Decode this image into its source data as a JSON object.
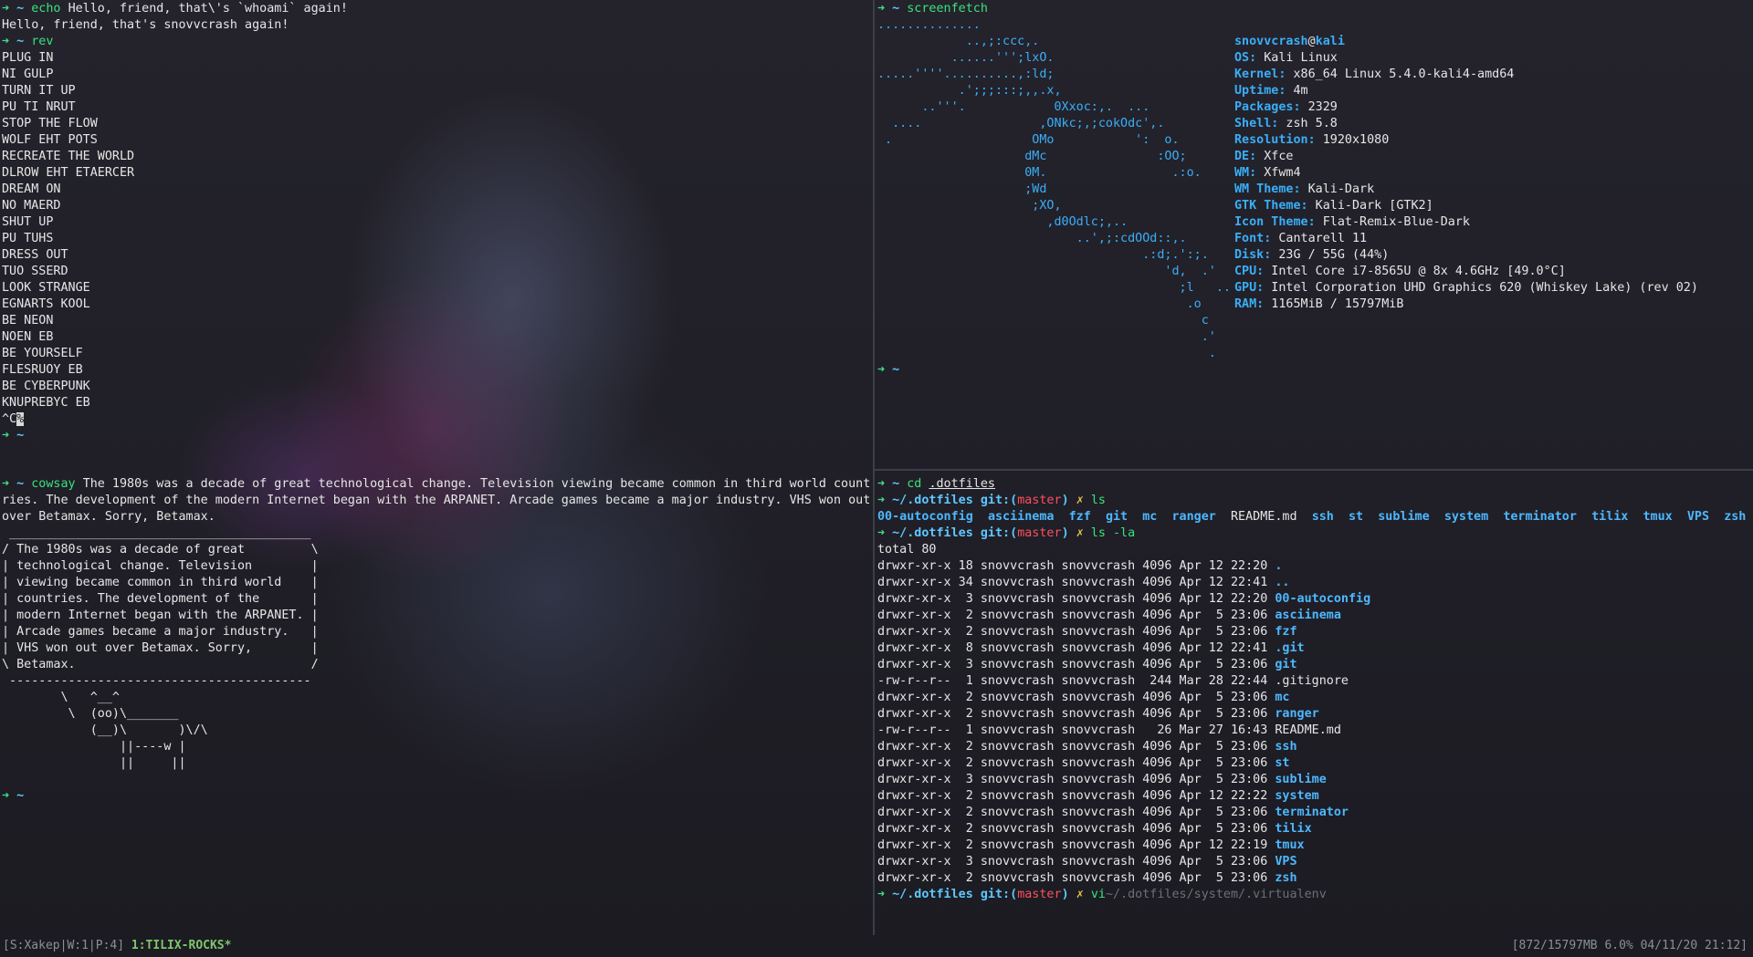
{
  "colors": {
    "background": "#1e1d25",
    "prompt_arrow": "#3ee08a",
    "prompt_path": "#5ec8ff",
    "command": "#39e37c",
    "git_branch": "#ff4f5e",
    "directory": "#4db8ff",
    "screenfetch_accent": "#3aaef8"
  },
  "icons": {
    "prompt": "arrow-icon",
    "dirty": "cross-mark-icon"
  },
  "tl": {
    "echo_prompt": "➜",
    "echo_path": "~",
    "echo_cmd": "echo",
    "echo_args": "Hello, friend, that\\'s `whoami` again!",
    "echo_output": "Hello, friend, that's snovvcrash again!",
    "rev_prompt": "➜",
    "rev_path": "~",
    "rev_cmd": "rev",
    "rev_lines": [
      "PLUG IN",
      "NI GULP",
      "TURN IT UP",
      "PU TI NRUT",
      "STOP THE FLOW",
      "WOLF EHT POTS",
      "RECREATE THE WORLD",
      "DLROW EHT ETAERCER",
      "DREAM ON",
      "NO MAERD",
      "SHUT UP",
      "PU TUHS",
      "DRESS OUT",
      "TUO SSERD",
      "LOOK STRANGE",
      "EGNARTS KOOL",
      "BE NEON",
      "NOEN EB",
      "BE YOURSELF",
      "FLESRUOY EB",
      "BE CYBERPUNK",
      "KNUPREBYC EB"
    ],
    "ctrlc": "^C",
    "ctrlc_cursor": "%",
    "final_prompt": "➜",
    "final_path": "~"
  },
  "tr": {
    "prompt": "➜",
    "path": "~",
    "cmd": "screenfetch",
    "art": [
      "..............",
      "            ..,;:ccc,.",
      "          ......''';lxO.",
      ".....''''..........,:ld;",
      "           .';;;:::;,,.x,",
      "      ..'''.            0Xxoc:,.  ...",
      "  ....                ,ONkc;,;cokOdc',.",
      " .                   OMo           ':  o.",
      "                    dMc               :OO;",
      "                    0M.                 .:o.",
      "                    ;Wd",
      "                     ;XO,",
      "                       ,d0Odlc;,..",
      "                           ..',;:cdOOd::,.",
      "                                    .:d;.':;.",
      "                                       'd,  .'",
      "                                         ;l   ..",
      "                                          .o",
      "                                            c",
      "                                            .'",
      "                                             ."
    ],
    "user": "snovvcrash",
    "at": "@",
    "host": "kali",
    "info": [
      {
        "k": "OS:",
        "v": " Kali Linux"
      },
      {
        "k": "Kernel:",
        "v": " x86_64 Linux 5.4.0-kali4-amd64"
      },
      {
        "k": "Uptime:",
        "v": " 4m"
      },
      {
        "k": "Packages:",
        "v": " 2329"
      },
      {
        "k": "Shell:",
        "v": " zsh 5.8"
      },
      {
        "k": "Resolution:",
        "v": " 1920x1080"
      },
      {
        "k": "DE:",
        "v": " Xfce"
      },
      {
        "k": "WM:",
        "v": " Xfwm4"
      },
      {
        "k": "WM Theme:",
        "v": " Kali-Dark"
      },
      {
        "k": "GTK Theme:",
        "v": " Kali-Dark [GTK2]"
      },
      {
        "k": "Icon Theme:",
        "v": " Flat-Remix-Blue-Dark"
      },
      {
        "k": "Font:",
        "v": " Cantarell 11"
      },
      {
        "k": "Disk:",
        "v": " 23G / 55G (44%)"
      },
      {
        "k": "CPU:",
        "v": " Intel Core i7-8565U @ 8x 4.6GHz [49.0°C]"
      },
      {
        "k": "GPU:",
        "v": " Intel Corporation UHD Graphics 620 (Whiskey Lake) (rev 02)"
      },
      {
        "k": "RAM:",
        "v": " 1165MiB / 15797MiB"
      }
    ],
    "final_prompt": "➜",
    "final_path": "~"
  },
  "bl": {
    "prompt": "➜",
    "path": "~",
    "cmd": "cowsay",
    "cmd_text_1": "The 1980s was a decade of great technological change. Television viewing became common in third world count",
    "cmd_text_2": "ries. The development of the modern Internet began with the ARPANET. Arcade games became a major industry. VHS won out",
    "cmd_text_3": "over Betamax. Sorry, Betamax.",
    "cow": [
      " _________________________________________",
      "/ The 1980s was a decade of great         \\",
      "| technological change. Television        |",
      "| viewing became common in third world    |",
      "| countries. The development of the       |",
      "| modern Internet began with the ARPANET. |",
      "| Arcade games became a major industry.   |",
      "| VHS won out over Betamax. Sorry,        |",
      "\\ Betamax.                                /",
      " -----------------------------------------",
      "        \\   ^__^",
      "         \\  (oo)\\_______",
      "            (__)\\       )\\/\\",
      "                ||----w |",
      "                ||     ||"
    ],
    "final_prompt": "➜",
    "final_path": "~"
  },
  "br": {
    "p1_prompt": "➜",
    "p1_path": "~",
    "p1_cmd": "cd",
    "p1_arg": ".dotfiles",
    "git_path": "~/.dotfiles",
    "git_label": "git:(",
    "git_branch": "master",
    "git_close": ")",
    "dirty_mark": "✗",
    "ls_cmd": "ls",
    "ls_items": [
      {
        "name": "00-autoconfig",
        "dir": true
      },
      {
        "name": "asciinema",
        "dir": true
      },
      {
        "name": "fzf",
        "dir": true
      },
      {
        "name": "git",
        "dir": true
      },
      {
        "name": "mc",
        "dir": true
      },
      {
        "name": "ranger",
        "dir": true
      },
      {
        "name": "README.md",
        "dir": false
      },
      {
        "name": "ssh",
        "dir": true
      },
      {
        "name": "st",
        "dir": true
      },
      {
        "name": "sublime",
        "dir": true
      },
      {
        "name": "system",
        "dir": true
      },
      {
        "name": "terminator",
        "dir": true
      },
      {
        "name": "tilix",
        "dir": true
      },
      {
        "name": "tmux",
        "dir": true
      },
      {
        "name": "VPS",
        "dir": true
      },
      {
        "name": "zsh",
        "dir": true
      }
    ],
    "lsla_cmd": "ls -la",
    "total": "total 80",
    "rows": [
      {
        "meta": "drwxr-xr-x 18 snovvcrash snovvcrash 4096 Apr 12 22:20 ",
        "name": ".",
        "dir": true
      },
      {
        "meta": "drwxr-xr-x 34 snovvcrash snovvcrash 4096 Apr 12 22:41 ",
        "name": "..",
        "dir": true
      },
      {
        "meta": "drwxr-xr-x  3 snovvcrash snovvcrash 4096 Apr 12 22:20 ",
        "name": "00-autoconfig",
        "dir": true
      },
      {
        "meta": "drwxr-xr-x  2 snovvcrash snovvcrash 4096 Apr  5 23:06 ",
        "name": "asciinema",
        "dir": true
      },
      {
        "meta": "drwxr-xr-x  2 snovvcrash snovvcrash 4096 Apr  5 23:06 ",
        "name": "fzf",
        "dir": true
      },
      {
        "meta": "drwxr-xr-x  8 snovvcrash snovvcrash 4096 Apr 12 22:41 ",
        "name": ".git",
        "dir": true
      },
      {
        "meta": "drwxr-xr-x  3 snovvcrash snovvcrash 4096 Apr  5 23:06 ",
        "name": "git",
        "dir": true
      },
      {
        "meta": "-rw-r--r--  1 snovvcrash snovvcrash  244 Mar 28 22:44 ",
        "name": ".gitignore",
        "dir": false
      },
      {
        "meta": "drwxr-xr-x  2 snovvcrash snovvcrash 4096 Apr  5 23:06 ",
        "name": "mc",
        "dir": true
      },
      {
        "meta": "drwxr-xr-x  2 snovvcrash snovvcrash 4096 Apr  5 23:06 ",
        "name": "ranger",
        "dir": true
      },
      {
        "meta": "-rw-r--r--  1 snovvcrash snovvcrash   26 Mar 27 16:43 ",
        "name": "README.md",
        "dir": false
      },
      {
        "meta": "drwxr-xr-x  2 snovvcrash snovvcrash 4096 Apr  5 23:06 ",
        "name": "ssh",
        "dir": true
      },
      {
        "meta": "drwxr-xr-x  2 snovvcrash snovvcrash 4096 Apr  5 23:06 ",
        "name": "st",
        "dir": true
      },
      {
        "meta": "drwxr-xr-x  3 snovvcrash snovvcrash 4096 Apr  5 23:06 ",
        "name": "sublime",
        "dir": true
      },
      {
        "meta": "drwxr-xr-x  2 snovvcrash snovvcrash 4096 Apr 12 22:22 ",
        "name": "system",
        "dir": true
      },
      {
        "meta": "drwxr-xr-x  2 snovvcrash snovvcrash 4096 Apr  5 23:06 ",
        "name": "terminator",
        "dir": true
      },
      {
        "meta": "drwxr-xr-x  2 snovvcrash snovvcrash 4096 Apr  5 23:06 ",
        "name": "tilix",
        "dir": true
      },
      {
        "meta": "drwxr-xr-x  2 snovvcrash snovvcrash 4096 Apr 12 22:19 ",
        "name": "tmux",
        "dir": true
      },
      {
        "meta": "drwxr-xr-x  3 snovvcrash snovvcrash 4096 Apr  5 23:06 ",
        "name": "VPS",
        "dir": true
      },
      {
        "meta": "drwxr-xr-x  2 snovvcrash snovvcrash 4096 Apr  5 23:06 ",
        "name": "zsh",
        "dir": true
      }
    ],
    "vi_cmd": "vi",
    "suggestion": "~/.dotfiles/system/.virtualenv"
  },
  "status": {
    "left": "[S:Xakep|W:1|P:4]",
    "session": "1:TILIX-ROCKS*",
    "right": "[872/15797MB  6.0% 04/11/20 21:12]"
  }
}
